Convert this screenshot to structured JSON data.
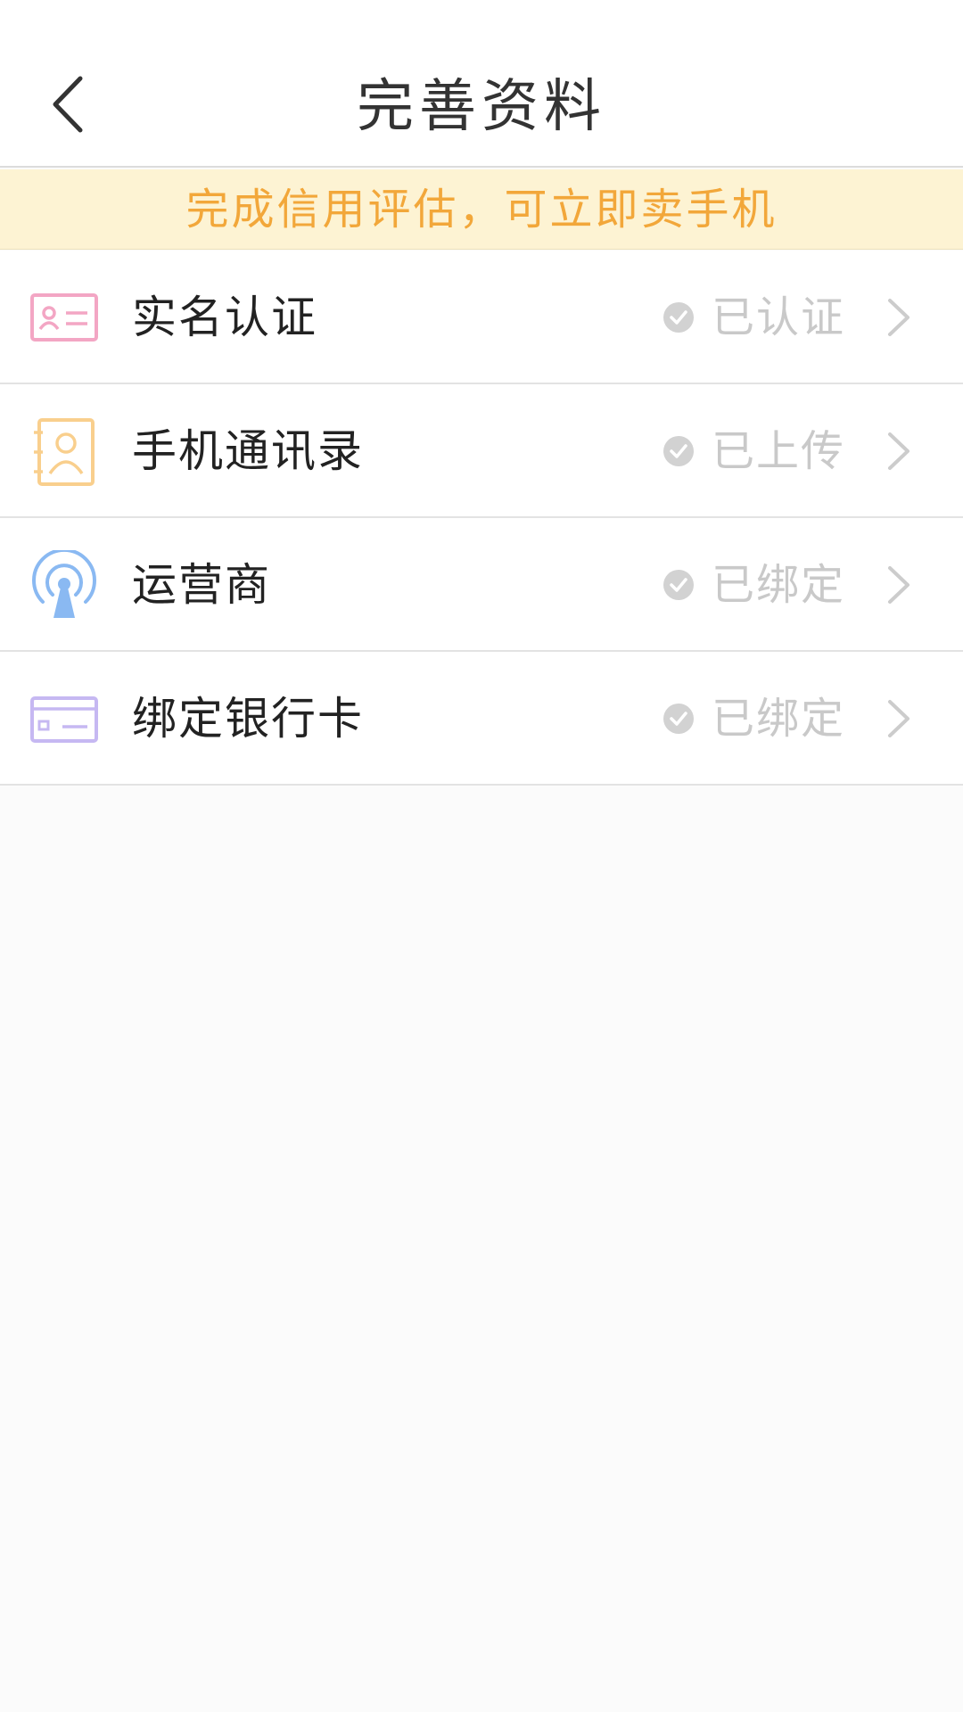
{
  "header": {
    "title": "完善资料",
    "back_icon": "chevron-left-icon"
  },
  "banner": {
    "text": "完成信用评估，可立即卖手机"
  },
  "items": [
    {
      "label": "实名认证",
      "status": "已认证",
      "icon": "id-card-icon",
      "color": "#f3a6c4"
    },
    {
      "label": "手机通讯录",
      "status": "已上传",
      "icon": "contacts-book-icon",
      "color": "#f9cf8d"
    },
    {
      "label": "运营商",
      "status": "已绑定",
      "icon": "signal-tower-icon",
      "color": "#8ab9f2"
    },
    {
      "label": "绑定银行卡",
      "status": "已绑定",
      "icon": "bank-card-icon",
      "color": "#c6b8f2"
    }
  ],
  "colors": {
    "banner_text": "#f2a73a",
    "banner_bg": "#fdf3d3",
    "status_gray": "#c9c9c9",
    "check_gray": "#d2d2d2"
  }
}
